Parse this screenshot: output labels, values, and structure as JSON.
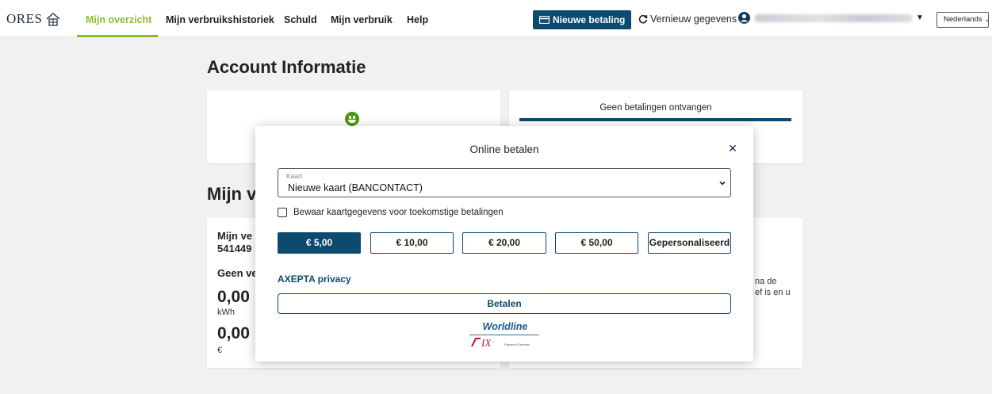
{
  "nav": {
    "logo_text": "ORES",
    "items": [
      "Mijn overzicht",
      "Mijn verbruikshistoriek",
      "Schuld",
      "Mijn verbruik",
      "Help"
    ],
    "new_payment": "Nieuwe betaling",
    "refresh": "Vernieuw gegevens",
    "language": "Nederlands"
  },
  "page": {
    "title": "Account Informatie",
    "section_title_partial": "Mijn v",
    "no_payments": "Geen betalingen ontvangen",
    "left_card": {
      "line1": "Mijn ve",
      "line2": "541449",
      "line3": "Geen ve",
      "value1": "0,00",
      "unit1": "kWh",
      "value2": "0,00",
      "unit2": "€"
    },
    "right_card": {
      "text1": "na de",
      "text2": "ef is en u"
    }
  },
  "modal": {
    "title": "Online betalen",
    "select_label": "Kaart",
    "select_value": "Nieuwe kaart (BANCONTACT)",
    "save_card_label": "Bewaar kaartgegevens voor toekomstige betalingen",
    "amounts": [
      "€ 5,00",
      "€ 10,00",
      "€ 20,00",
      "€ 50,00",
      "Gepersonaliseerd"
    ],
    "selected_amount": "€ 5,00",
    "privacy_link": "AXEPTA privacy",
    "pay_button": "Betalen",
    "footer_brand": "Worldline",
    "footer_sub": "Payment Services"
  },
  "colors": {
    "accent_green": "#8dbb2f",
    "primary_blue": "#0c4a6e",
    "background": "#f1f1f1"
  }
}
